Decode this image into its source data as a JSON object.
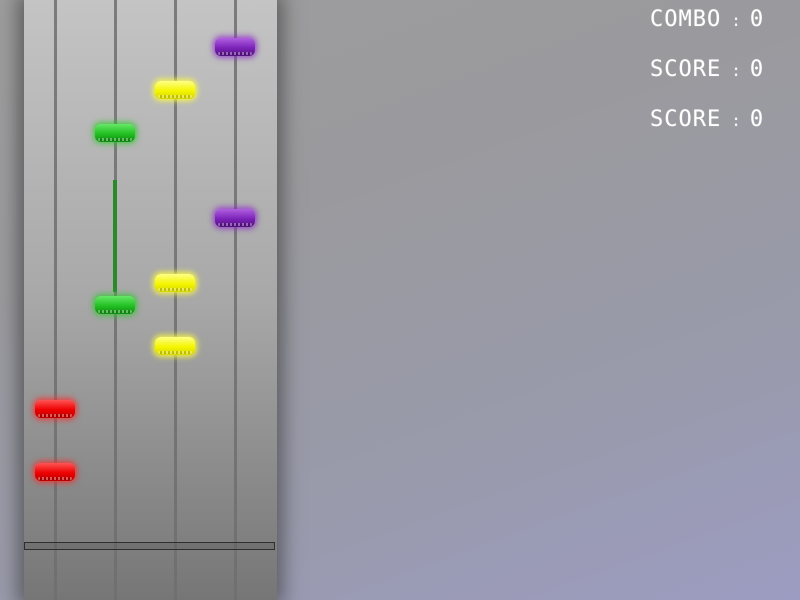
{
  "hud": {
    "combo_label": "COMBO",
    "combo_value": "0",
    "score_label": "SCORE",
    "score_value": "0",
    "score2_label": "SCORE",
    "score2_value": "0",
    "separator": ":"
  },
  "lanes": [
    {
      "color": "red",
      "hex": "#ee0000"
    },
    {
      "color": "green",
      "hex": "#22c022"
    },
    {
      "color": "yellow",
      "hex": "#f5f500"
    },
    {
      "color": "purple",
      "hex": "#7b22b8"
    }
  ],
  "notes": [
    {
      "lane": "purple",
      "row": 1
    },
    {
      "lane": "yellow",
      "row": 2
    },
    {
      "lane": "green",
      "row": 3,
      "sustain_start": true
    },
    {
      "lane": "purple",
      "row": 4
    },
    {
      "lane": "yellow",
      "row": 5
    },
    {
      "lane": "green",
      "row": 5,
      "sustain_end": true
    },
    {
      "lane": "yellow",
      "row": 6
    },
    {
      "lane": "red",
      "row": 7
    },
    {
      "lane": "red",
      "row": 8
    }
  ]
}
